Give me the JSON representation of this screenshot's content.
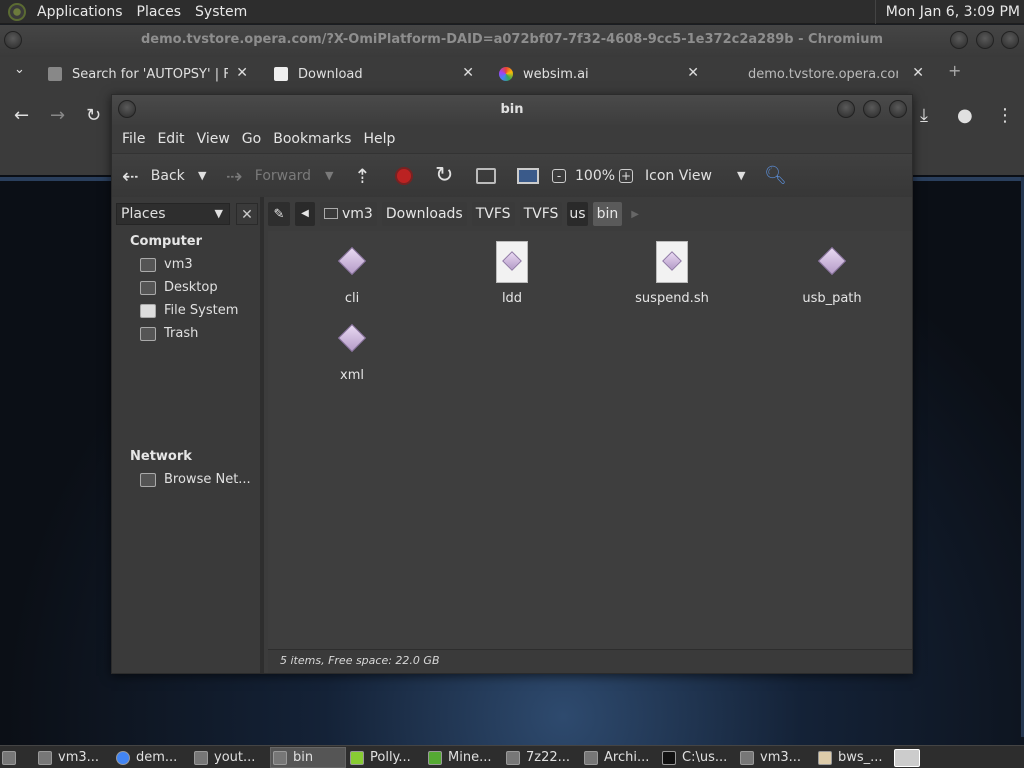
{
  "top_panel": {
    "menus": [
      "Applications",
      "Places",
      "System"
    ],
    "clock": "Mon Jan  6,  3:09 PM"
  },
  "browser": {
    "window_title": "demo.tvstore.opera.com/?X-OmiPlatform-DAID=a072bf07-7f32-4608-9cc5-1e372c2a289b - Chromium",
    "tabs": [
      {
        "label": "Search for 'AUTOPSY' | Fla",
        "icon": "puzzle-icon"
      },
      {
        "label": "Download",
        "icon": "page-icon"
      },
      {
        "label": "websim.ai",
        "icon": "websim-icon"
      },
      {
        "label": "demo.tvstore.opera.com/?",
        "icon": "none"
      }
    ],
    "new_tab": "+"
  },
  "file_manager": {
    "title": "bin",
    "menus": [
      "File",
      "Edit",
      "View",
      "Go",
      "Bookmarks",
      "Help"
    ],
    "toolbar": {
      "back": "Back",
      "forward": "Forward",
      "zoom": "100%",
      "view_mode": "Icon View"
    },
    "sidebar": {
      "selector": "Places",
      "sections": [
        {
          "heading": "Computer",
          "items": [
            "vm3",
            "Desktop",
            "File System",
            "Trash"
          ]
        },
        {
          "heading": "Network",
          "items": [
            "Browse Net..."
          ]
        }
      ]
    },
    "breadcrumbs": [
      "vm3",
      "Downloads",
      "TVFS",
      "TVFS",
      "us",
      "bin"
    ],
    "files": [
      {
        "name": "cli",
        "icon": "executable-icon"
      },
      {
        "name": "ldd",
        "icon": "script-icon"
      },
      {
        "name": "suspend.sh",
        "icon": "script-icon"
      },
      {
        "name": "usb_path",
        "icon": "executable-icon"
      },
      {
        "name": "xml",
        "icon": "executable-icon"
      }
    ],
    "status": "5 items, Free space: 22.0 GB"
  },
  "taskbar": {
    "items": [
      "vm3...",
      "dem...",
      "yout...",
      "bin",
      "Polly...",
      "Mine...",
      "7z22...",
      "Archi...",
      "C:\\us...",
      "vm3...",
      "bws_..."
    ]
  }
}
